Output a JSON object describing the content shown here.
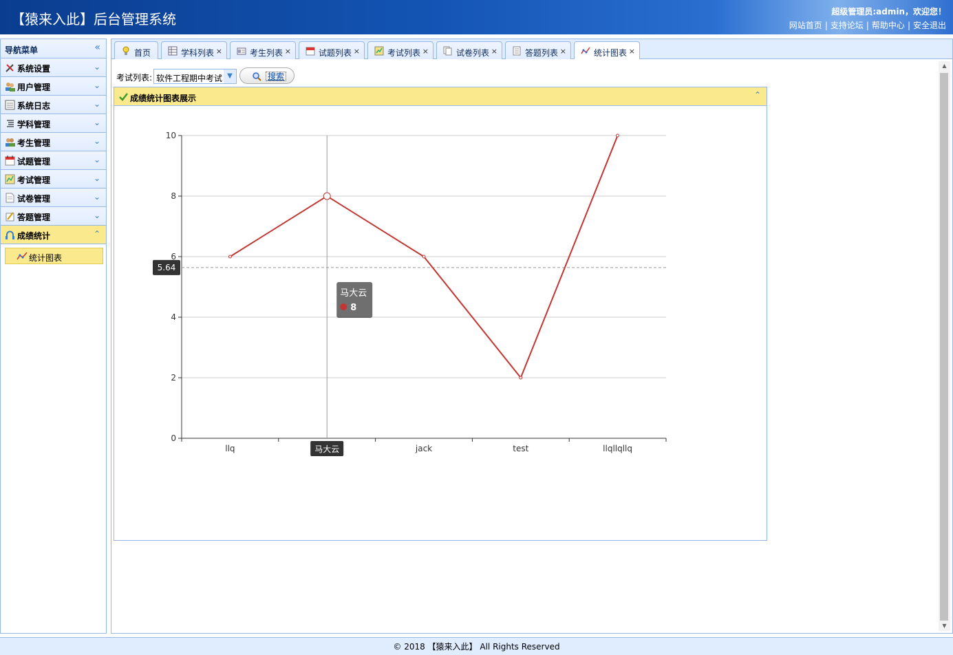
{
  "header": {
    "title": "【猿来入此】后台管理系统",
    "user_text": "超级管理员:admin，欢迎您！",
    "links": [
      "网站首页",
      "支持论坛",
      "帮助中心",
      "安全退出"
    ]
  },
  "sidebar": {
    "title": "导航菜单",
    "items": [
      {
        "label": "系统设置",
        "icon": "tools-icon"
      },
      {
        "label": "用户管理",
        "icon": "users-icon"
      },
      {
        "label": "系统日志",
        "icon": "log-icon"
      },
      {
        "label": "学科管理",
        "icon": "list-icon"
      },
      {
        "label": "考生管理",
        "icon": "students-icon"
      },
      {
        "label": "试题管理",
        "icon": "calendar-icon"
      },
      {
        "label": "考试管理",
        "icon": "exam-icon"
      },
      {
        "label": "试卷管理",
        "icon": "paper-icon"
      },
      {
        "label": "答题管理",
        "icon": "answer-icon"
      },
      {
        "label": "成绩统计",
        "icon": "stats-icon"
      }
    ],
    "sub_item": "统计图表"
  },
  "tabs": [
    {
      "label": "首页",
      "closable": false
    },
    {
      "label": "学科列表",
      "closable": true
    },
    {
      "label": "考生列表",
      "closable": true
    },
    {
      "label": "试题列表",
      "closable": true
    },
    {
      "label": "考试列表",
      "closable": true
    },
    {
      "label": "试卷列表",
      "closable": true
    },
    {
      "label": "答题列表",
      "closable": true
    },
    {
      "label": "统计图表",
      "closable": true
    }
  ],
  "filter": {
    "label": "考试列表:",
    "selected": "软件工程期中考试",
    "search_label": "搜索"
  },
  "panel": {
    "title": "成绩统计图表展示"
  },
  "chart_data": {
    "type": "line",
    "categories": [
      "llq",
      "马大云",
      "jack",
      "test",
      "llqllqllq"
    ],
    "values": [
      6,
      8,
      6,
      2,
      10
    ],
    "ylim": [
      0,
      10
    ],
    "yticks": [
      0,
      2,
      4,
      6,
      8,
      10
    ],
    "average": 5.64,
    "average_label": "5.64",
    "color": "#c23531",
    "grid": true,
    "tooltip": {
      "category": "马大云",
      "value": "8"
    },
    "hover_category_label": "马大云"
  },
  "footer": {
    "text": "© 2018 【猿来入此】 All Rights Reserved"
  }
}
